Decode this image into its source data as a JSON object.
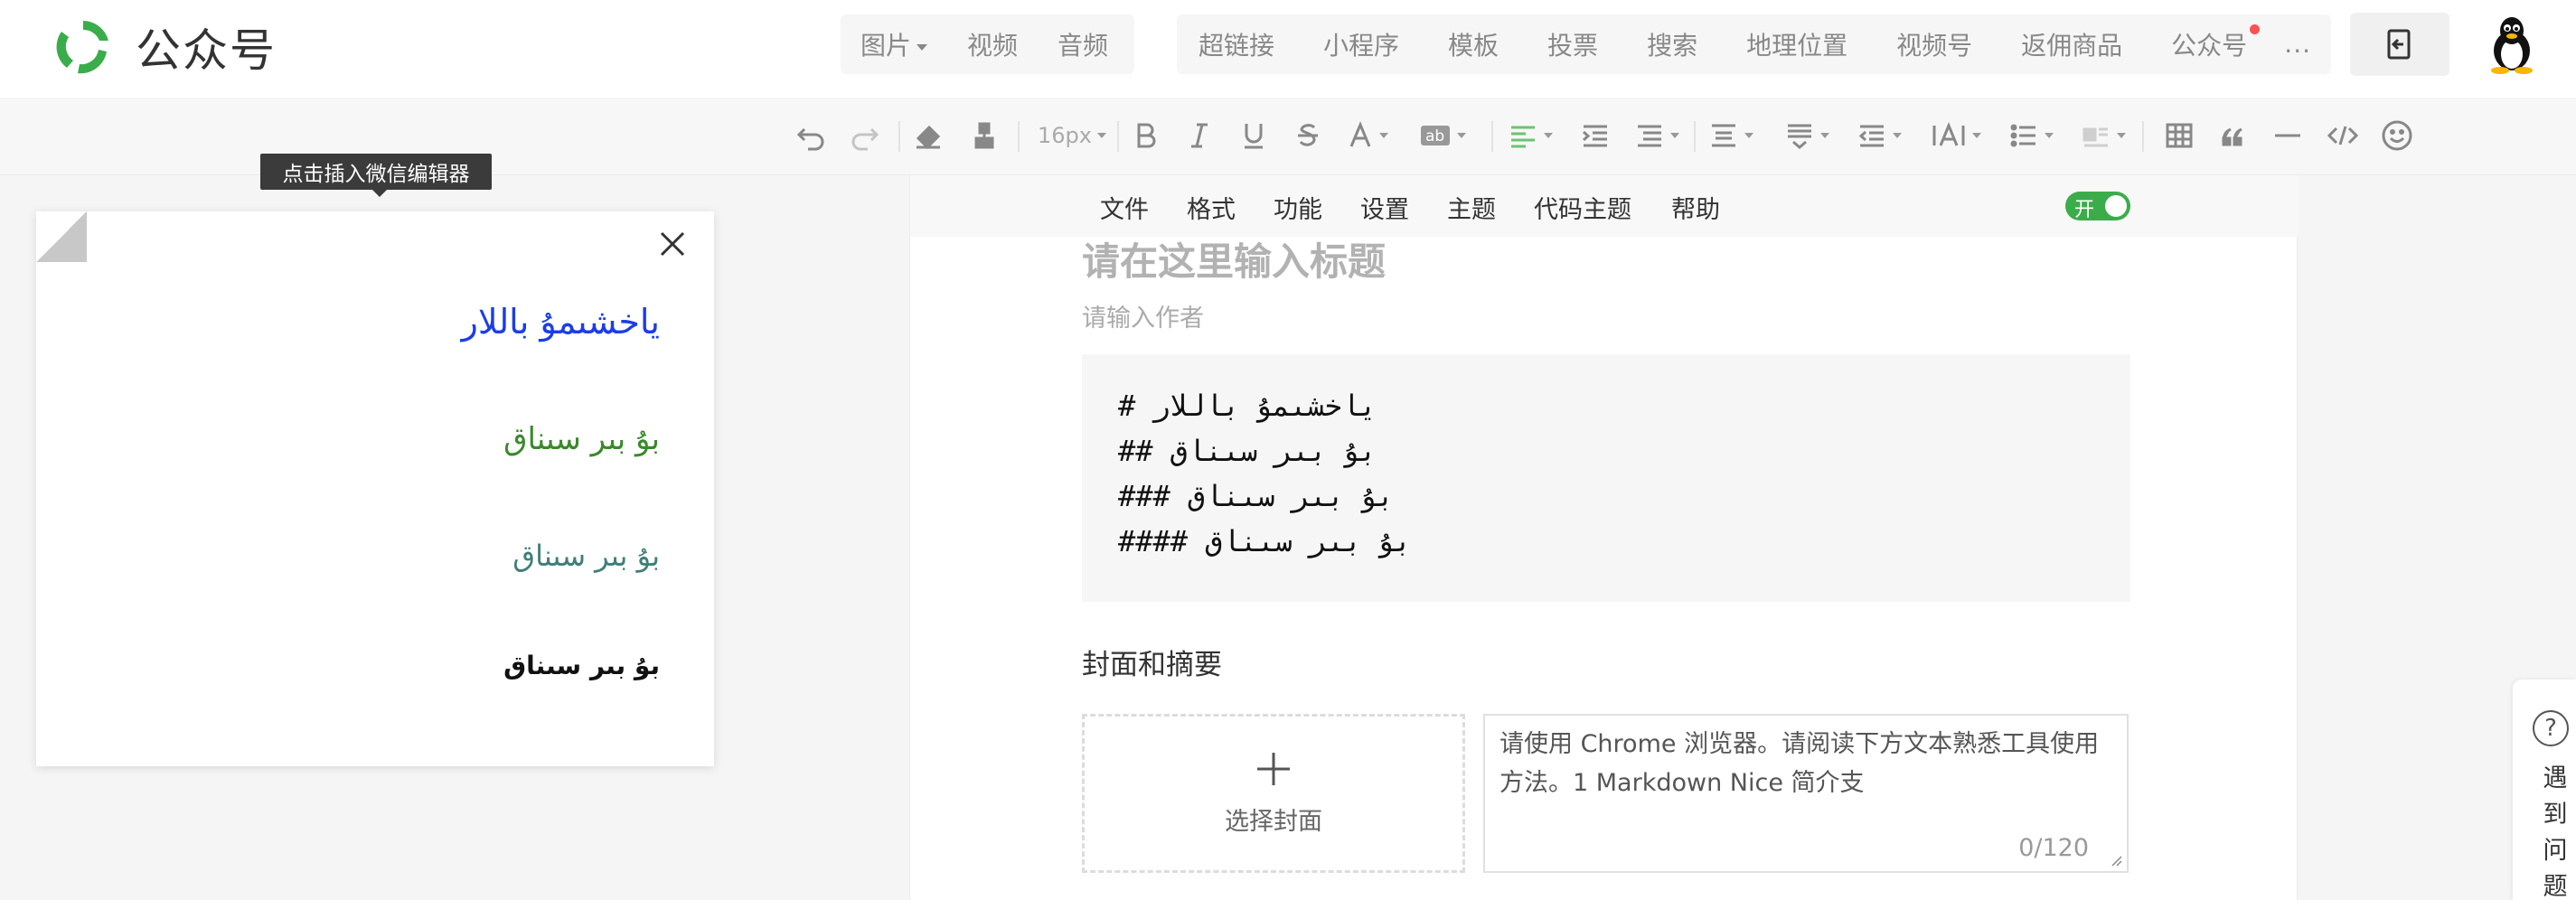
{
  "app": {
    "name": "公众号",
    "brand_color": "#3aad4a"
  },
  "nav": {
    "media": [
      {
        "label": "图片",
        "dropdown": true
      },
      {
        "label": "视频"
      },
      {
        "label": "音频"
      }
    ],
    "insert": [
      {
        "label": "超链接"
      },
      {
        "label": "小程序"
      },
      {
        "label": "模板"
      },
      {
        "label": "投票"
      },
      {
        "label": "搜索"
      },
      {
        "label": "地理位置"
      },
      {
        "label": "视频号"
      },
      {
        "label": "返佣商品"
      },
      {
        "label": "公众号",
        "badge": "red-dot"
      }
    ],
    "more_label": "···"
  },
  "toolbar": {
    "font_size": "16px",
    "icons": [
      "undo-icon",
      "redo-icon",
      "eraser-icon",
      "format-painter-icon",
      "bold-icon",
      "italic-icon",
      "underline-icon",
      "strikethrough-icon",
      "font-color-icon",
      "highlight-icon",
      "align-left-icon",
      "indent-icon",
      "paragraph-spacing-icon",
      "line-height-icon",
      "letter-spacing-icon",
      "outdent-icon",
      "text-width-icon",
      "list-icon",
      "image-align-icon",
      "table-icon",
      "quote-icon",
      "divider-icon",
      "code-icon",
      "emoji-icon"
    ]
  },
  "tooltip": "点击插入微信编辑器",
  "preview": {
    "lines": [
      {
        "text": "ياخشىمۇ باللار",
        "level": "h1",
        "color": "#1b3de8"
      },
      {
        "text": "بۇ بىر سىناق",
        "level": "h2",
        "color": "#3a8a2b"
      },
      {
        "text": "بۇ بىر سىناق",
        "level": "h3",
        "color": "#3f7f7a"
      },
      {
        "text": "بۇ بىر سىناق",
        "level": "h4",
        "color": "#111111"
      }
    ]
  },
  "editor": {
    "menu": [
      "文件",
      "格式",
      "功能",
      "设置",
      "主题",
      "代码主题",
      "帮助"
    ],
    "toggle_label": "开",
    "title_placeholder": "请在这里输入标题",
    "author_placeholder": "请输入作者",
    "code_lines": [
      "# ياخشىمۇ باللار",
      "## بۇ بىر سىناق",
      "### بۇ بىر سىناق",
      "#### بۇ بىر سىناق"
    ],
    "cover_section_label": "封面和摘要",
    "cover_button": "选择封面",
    "summary_text": "请使用 Chrome 浏览器。请阅读下方文本熟悉工具使用方法。1 Markdown Nice 简介支",
    "summary_count": "0/120"
  },
  "help": {
    "label": "遇到问题"
  }
}
